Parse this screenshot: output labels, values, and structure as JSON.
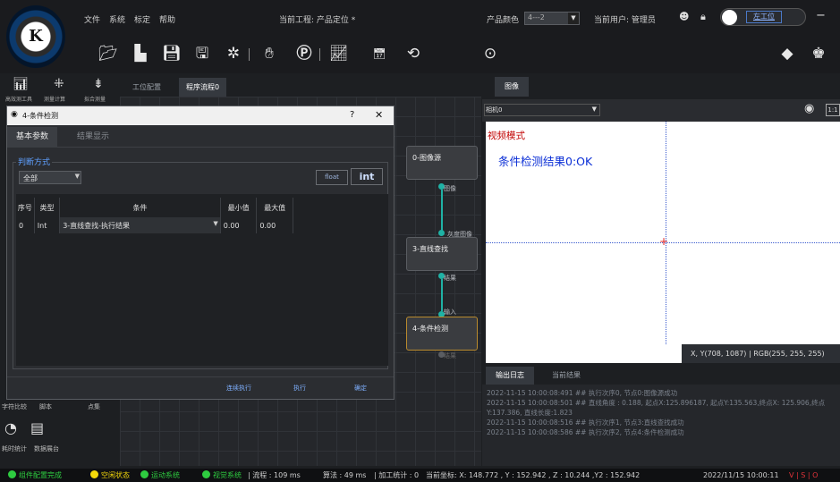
{
  "menu": [
    "文件",
    "系统",
    "标定",
    "帮助"
  ],
  "project": "当前工程: 产品定位 *",
  "product_color_label": "产品颜色",
  "product_color_value": "4---2",
  "current_user": "当前用户: 管理员",
  "station_button": "左工位",
  "logo_letter": "K",
  "left_tools": {
    "row1": "高效测工具",
    "row2": "测量计算",
    "row3": "拟合测量"
  },
  "canvas_tabs": [
    "工位配置",
    "程序流程0"
  ],
  "dialog": {
    "title": "4-条件检测",
    "help": "?",
    "close": "✕",
    "tabs": [
      "基本参数",
      "结果显示"
    ],
    "group_label": "判断方式",
    "mode_value": "全部",
    "btn_float": "float",
    "btn_int": "int",
    "table_headers": [
      "序号",
      "类型",
      "条件",
      "最小值",
      "最大值"
    ],
    "rows": [
      {
        "index": "0",
        "type": "Int",
        "condition": "3-直线查找-执行结果",
        "min": "0.00",
        "max": "0.00"
      }
    ],
    "buttons": {
      "continuous": "连续执行",
      "execute": "执行",
      "confirm": "确定"
    }
  },
  "nodes": [
    {
      "title": "0-图像源",
      "out_pin": "图像"
    },
    {
      "in_pin": "灰度图像",
      "title": "3-直线查找",
      "out_pin": "结果"
    },
    {
      "in_pin": "输入",
      "title": "4-条件检测",
      "out_pin": "结果"
    }
  ],
  "left_low": {
    "row1": [
      "字符比较",
      "脚本",
      "点集"
    ],
    "row2": [
      "耗时统计",
      "数据展台"
    ]
  },
  "image_panel": {
    "tab": "图像",
    "camera_select": "相机0",
    "mode_text": "视频模式",
    "result_text": "条件检测结果0:OK",
    "coords": "X, Y(708, 1087)  | RGB(255, 255, 255)",
    "scale_button": "1:1",
    "colors": {
      "mode": "#c00000",
      "result": "#0b2fd6",
      "crosshair": "#e02020"
    }
  },
  "log": {
    "tabs": [
      "输出日志",
      "当前结果"
    ],
    "lines": [
      "2022-11-15 10:00:08:491 ## 执行次序0, 节点0:图像源成功",
      "2022-11-15 10:00:08:501 ## 直线角度 : 0.188, 起点X:125.896187, 起点Y:135.563,终点X: 125.906,终点Y:137.386, 直线长度:1.823",
      "2022-11-15 10:00:08:516 ## 执行次序1, 节点3:直线查找成功",
      "2022-11-15 10:00:08:586 ## 执行次序2, 节点4:条件检测成功"
    ]
  },
  "status": {
    "items": [
      {
        "text": "组件配置完成",
        "color": "#2ecc40"
      },
      {
        "text": "空闲状态",
        "color": "#f5d90a"
      },
      {
        "text": "运动系统",
        "color": "#2ecc40"
      },
      {
        "text": "视觉系统",
        "color": "#2ecc40"
      }
    ],
    "flow": "| 流程 : 109 ms",
    "algo": "算法 : 49 ms",
    "stats": "| 加工统计 : 0",
    "coords": "当前坐标: X: 148.772 , Y : 152.942 , Z : 10.244 ,Y2 : 152.942",
    "datetime": "2022/11/15 10:00:11",
    "tail": "V | S | O"
  }
}
